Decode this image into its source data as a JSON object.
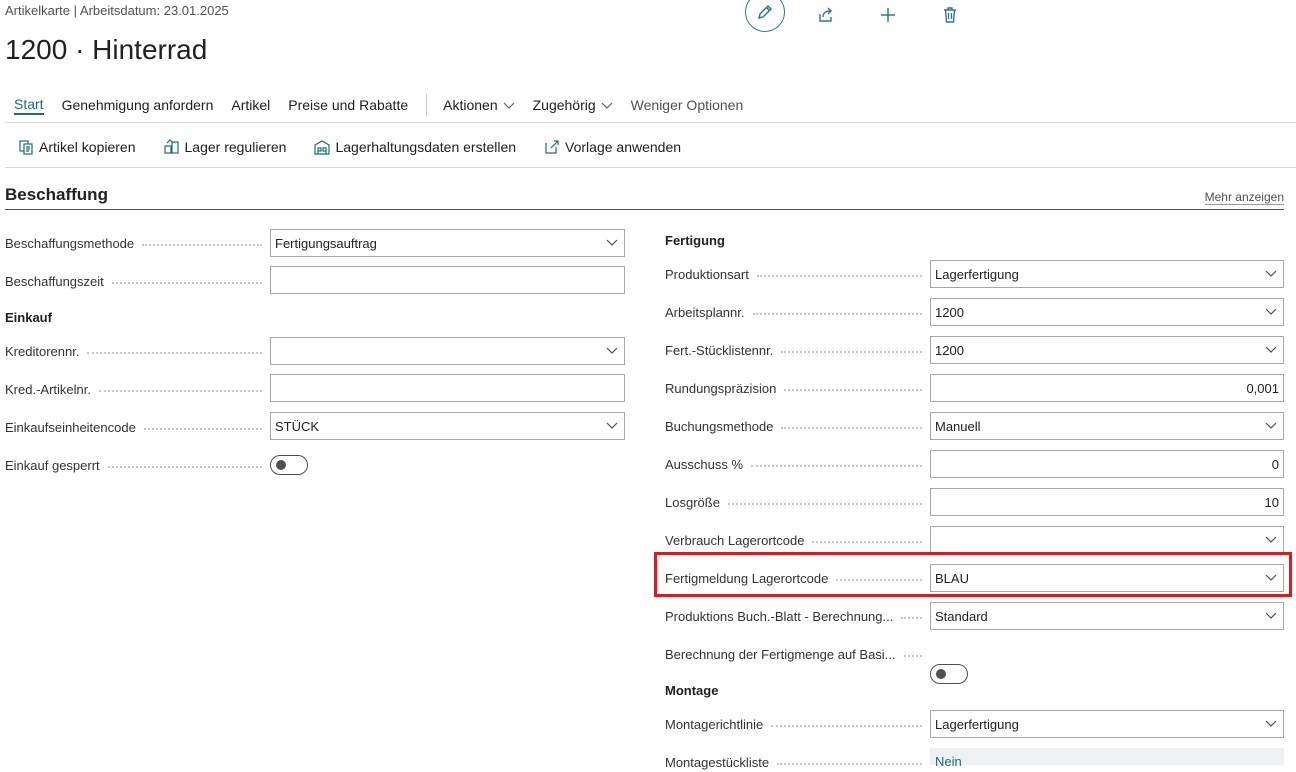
{
  "header": {
    "breadcrumb": "Artikelkarte | Arbeitsdatum: 23.01.2025",
    "title": "1200 · Hinterrad"
  },
  "toolbar_icons": [
    "edit-icon",
    "share-icon",
    "add-icon",
    "delete-icon"
  ],
  "actionbar": {
    "start": "Start",
    "genehmigung": "Genehmigung anfordern",
    "artikel": "Artikel",
    "preise": "Preise und Rabatte",
    "aktionen": "Aktionen",
    "zugehoerig": "Zugehörig",
    "weniger": "Weniger Optionen"
  },
  "subactions": {
    "artikel_kopieren": "Artikel kopieren",
    "lager_regulieren": "Lager regulieren",
    "lagerhaltungsdaten": "Lagerhaltungsdaten erstellen",
    "vorlage": "Vorlage anwenden"
  },
  "section": {
    "title": "Beschaffung",
    "mehr": "Mehr anzeigen"
  },
  "left": {
    "beschaffungsmethode": {
      "label": "Beschaffungsmethode",
      "value": "Fertigungsauftrag"
    },
    "beschaffungszeit": {
      "label": "Beschaffungszeit",
      "value": ""
    },
    "einkauf_title": "Einkauf",
    "kreditorennr": {
      "label": "Kreditorennr.",
      "value": ""
    },
    "kred_artikelnr": {
      "label": "Kred.-Artikelnr.",
      "value": ""
    },
    "einkaufseinheitencode": {
      "label": "Einkaufseinheitencode",
      "value": "STÜCK"
    },
    "einkauf_gesperrt": {
      "label": "Einkauf gesperrt",
      "value": false
    }
  },
  "right": {
    "fertigung_title": "Fertigung",
    "produktionsart": {
      "label": "Produktionsart",
      "value": "Lagerfertigung"
    },
    "arbeitsplannr": {
      "label": "Arbeitsplannr.",
      "value": "1200"
    },
    "stuecklistennr": {
      "label": "Fert.-Stücklistennr.",
      "value": "1200"
    },
    "rundungspraezision": {
      "label": "Rundungspräzision",
      "value": "0,001"
    },
    "buchungsmethode": {
      "label": "Buchungsmethode",
      "value": "Manuell"
    },
    "ausschuss": {
      "label": "Ausschuss %",
      "value": "0"
    },
    "losgroesse": {
      "label": "Losgröße",
      "value": "10"
    },
    "verbrauch_lagerortcode": {
      "label": "Verbrauch Lagerortcode",
      "value": ""
    },
    "fertigmeldung_lagerortcode": {
      "label": "Fertigmeldung Lagerortcode",
      "value": "BLAU"
    },
    "prod_buchblatt": {
      "label": "Produktions Buch.-Blatt - Berechnung...",
      "value": "Standard"
    },
    "berechnung_fertigmenge": {
      "label": "Berechnung der Fertigmenge auf Basi...",
      "value": false
    },
    "montage_title": "Montage",
    "montagerichtlinie": {
      "label": "Montagerichtlinie",
      "value": "Lagerfertigung"
    },
    "montagestueckliste": {
      "label": "Montagestückliste",
      "value": "Nein"
    }
  },
  "colors": {
    "accent": "#1c6d7c",
    "highlight": "#e0191e"
  }
}
